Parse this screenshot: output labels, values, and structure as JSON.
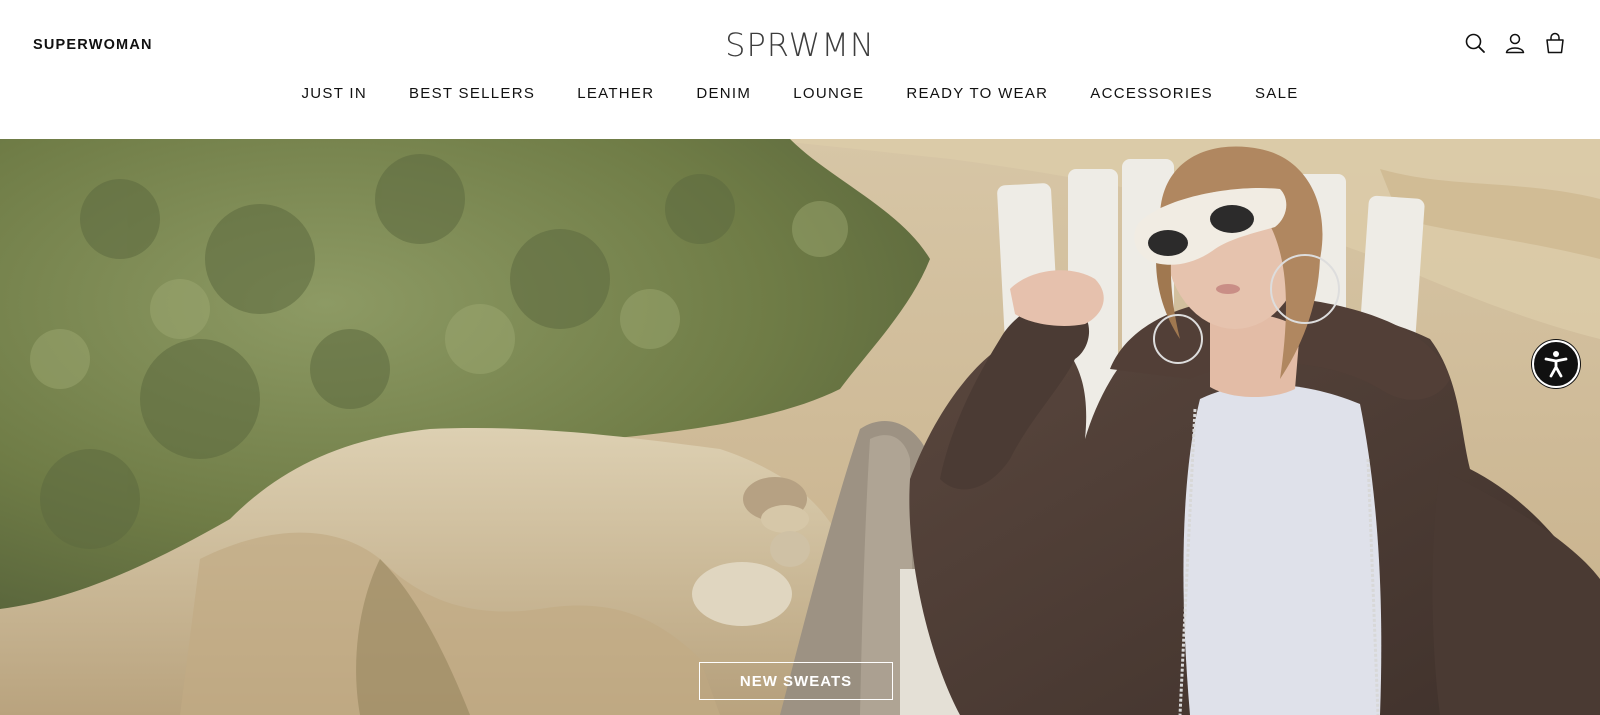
{
  "header": {
    "brand_left": "SUPERWOMAN",
    "logo": "SPRWMN",
    "icons": [
      "search-icon",
      "account-icon",
      "cart-icon"
    ]
  },
  "nav": {
    "items": [
      "JUST IN",
      "BEST SELLERS",
      "LEATHER",
      "DENIM",
      "LOUNGE",
      "READY TO WEAR",
      "ACCESSORIES",
      "SALE"
    ]
  },
  "hero": {
    "cta_label": "NEW SWEATS",
    "image": "model-in-brown-hoodie-on-beach-chair"
  },
  "accessibility": {
    "icon": "accessibility-icon"
  },
  "colors": {
    "text": "#111111",
    "logo": "#3d3d3d",
    "hoodie": "#4a3a33",
    "sand": "#cdb898",
    "foliage": "#7d8a55"
  }
}
